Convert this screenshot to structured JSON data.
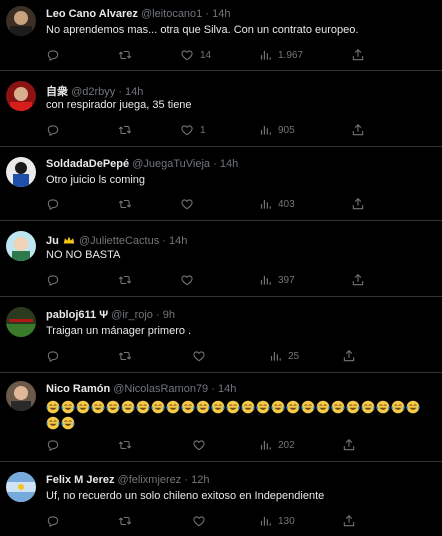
{
  "tweets": [
    {
      "name": "Leo Cano Alvarez",
      "handle": "@leitocano1",
      "time": "14h",
      "text": "No aprendemos mas... otra que Silva. Con un contrato europeo.",
      "replies": "",
      "retweets": "",
      "likes": "14",
      "views": "1.967"
    },
    {
      "name": "自衆",
      "handle": "@d2rbyy",
      "time": "14h",
      "text": "con respirador juega, 35 tiene",
      "replies": "",
      "retweets": "",
      "likes": "1",
      "views": "905"
    },
    {
      "name": "SoldadaDePepé",
      "handle": "@JuegaTuVieja",
      "time": "14h",
      "text": "Otro juicio ls coming",
      "replies": "",
      "retweets": "",
      "likes": "",
      "views": "403"
    },
    {
      "name": "Ju",
      "handle": "@JulietteCactus",
      "time": "14h",
      "text": "NO NO BASTA",
      "replies": "",
      "retweets": "",
      "likes": "",
      "views": "397"
    },
    {
      "name": "pabloj611",
      "handle": "@ir_rojo",
      "time": "9h",
      "text": "Traigan un mánager primero .",
      "replies": "",
      "retweets": "",
      "likes": "",
      "views": "25"
    },
    {
      "name": "Nico Ramón",
      "handle": "@NicolasRamon79",
      "time": "14h",
      "text": "",
      "emoji_count": 27,
      "replies": "",
      "retweets": "",
      "likes": "",
      "views": "202"
    },
    {
      "name": "Felix M Jerez",
      "handle": "@felixmjerez",
      "time": "12h",
      "text": "Uf, no recuerdo un solo chileno exitoso en Independiente",
      "replies": "",
      "retweets": "",
      "likes": "",
      "views": "130"
    }
  ],
  "sep": "·",
  "colors": {
    "bg": "#000000",
    "text": "#e7e9ea",
    "muted": "#71767b",
    "border": "#2f3336"
  }
}
